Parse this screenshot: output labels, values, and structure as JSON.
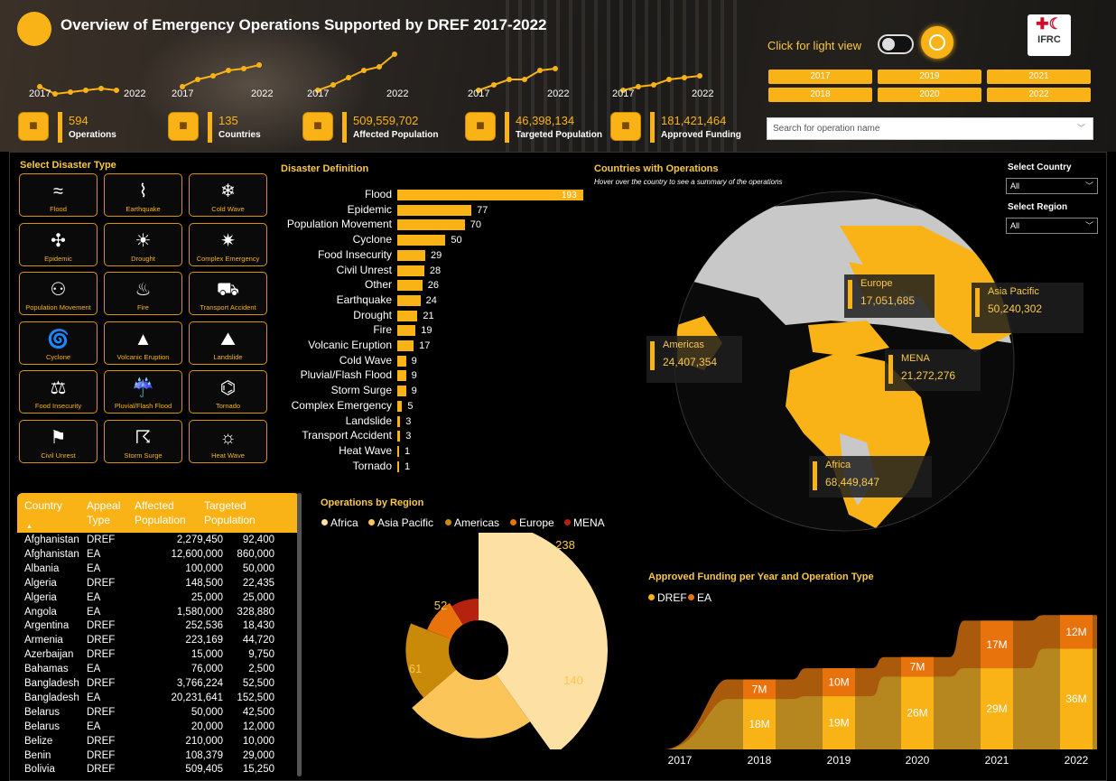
{
  "header": {
    "title": "Overview of Emergency Operations Supported by DREF 2017-2022",
    "light_view_label": "Click for light view",
    "logo_text": "IFRC",
    "search_placeholder": "Search for operation name"
  },
  "kpis": [
    {
      "value": "594",
      "label": "Operations",
      "icon": "people-icon"
    },
    {
      "value": "135",
      "label": "Countries",
      "icon": "map-pin-icon"
    },
    {
      "value": "509,559,702",
      "label": "Affected Population",
      "icon": "family-icon"
    },
    {
      "value": "46,398,134",
      "label": "Targeted Population",
      "icon": "target-people-icon"
    },
    {
      "value": "181,421,464",
      "label": "Approved Funding",
      "icon": "money-icon"
    }
  ],
  "sparklines": [
    {
      "start": "2017",
      "end": "2022"
    },
    {
      "start": "2017",
      "end": "2022"
    },
    {
      "start": "2017",
      "end": "2022"
    },
    {
      "start": "2017",
      "end": "2022"
    },
    {
      "start": "2017",
      "end": "2022"
    }
  ],
  "year_buttons": [
    "2017",
    "2019",
    "2021",
    "2018",
    "2020",
    "2022"
  ],
  "disaster_types": {
    "title": "Select Disaster Type",
    "items": [
      {
        "label": "Flood",
        "icon": "flood-icon",
        "glyph": "≈"
      },
      {
        "label": "Earthquake",
        "icon": "earthquake-icon",
        "glyph": "⌇"
      },
      {
        "label": "Cold Wave",
        "icon": "cold-wave-icon",
        "glyph": "❄"
      },
      {
        "label": "Epidemic",
        "icon": "epidemic-icon",
        "glyph": "✣"
      },
      {
        "label": "Drought",
        "icon": "drought-icon",
        "glyph": "☀"
      },
      {
        "label": "Complex Emergency",
        "icon": "complex-emergency-icon",
        "glyph": "✷"
      },
      {
        "label": "Population Movement",
        "icon": "population-movement-icon",
        "glyph": "⚇"
      },
      {
        "label": "Fire",
        "icon": "fire-icon",
        "glyph": "♨"
      },
      {
        "label": "Transport Accident",
        "icon": "transport-accident-icon",
        "glyph": "⛟"
      },
      {
        "label": "Cyclone",
        "icon": "cyclone-icon",
        "glyph": "🌀"
      },
      {
        "label": "Volcanic Eruption",
        "icon": "volcanic-eruption-icon",
        "glyph": "▲"
      },
      {
        "label": "Landslide",
        "icon": "landslide-icon",
        "glyph": "⛰"
      },
      {
        "label": "Food Insecurity",
        "icon": "food-insecurity-icon",
        "glyph": "⚖"
      },
      {
        "label": "Pluvial/Flash Flood",
        "icon": "flash-flood-icon",
        "glyph": "☔"
      },
      {
        "label": "Tornado",
        "icon": "tornado-icon",
        "glyph": "⌬"
      },
      {
        "label": "Civil Unrest",
        "icon": "civil-unrest-icon",
        "glyph": "⚑"
      },
      {
        "label": "Storm Surge",
        "icon": "storm-surge-icon",
        "glyph": "☈"
      },
      {
        "label": "Heat Wave",
        "icon": "heat-wave-icon",
        "glyph": "☼"
      }
    ]
  },
  "disaster_definition": {
    "title": "Disaster Definition",
    "chart_data": {
      "type": "bar",
      "categories": [
        "Flood",
        "Epidemic",
        "Population Movement",
        "Cyclone",
        "Food Insecurity",
        "Civil Unrest",
        "Other",
        "Earthquake",
        "Drought",
        "Fire",
        "Volcanic Eruption",
        "Cold Wave",
        "Pluvial/Flash Flood",
        "Storm Surge",
        "Complex Emergency",
        "Landslide",
        "Transport Accident",
        "Heat Wave",
        "Tornado"
      ],
      "values": [
        193,
        77,
        70,
        50,
        29,
        28,
        26,
        24,
        21,
        19,
        17,
        9,
        9,
        9,
        5,
        3,
        3,
        1,
        1
      ]
    }
  },
  "map": {
    "title": "Countries with Operations",
    "subtitle": "Hover over the country to see a summary of the operations",
    "select_country_label": "Select Country",
    "select_country_value": "All",
    "select_region_label": "Select Region",
    "select_region_value": "All",
    "regions": [
      {
        "name": "Europe",
        "value": "17,051,685"
      },
      {
        "name": "Asia Pacific",
        "value": "50,240,302"
      },
      {
        "name": "Americas",
        "value": "24,407,354"
      },
      {
        "name": "MENA",
        "value": "21,272,276"
      },
      {
        "name": "Africa",
        "value": "68,449,847"
      }
    ]
  },
  "table": {
    "headers": {
      "country": "Country",
      "appeal_line1": "Appeal",
      "appeal_line2": "Type",
      "affected_line1": "Affected",
      "affected_line2": "Population",
      "targeted_line1": "Targeted",
      "targeted_line2": "Population"
    },
    "rows": [
      [
        "Afghanistan",
        "DREF",
        "2,279,450",
        "92,400"
      ],
      [
        "Afghanistan",
        "EA",
        "12,600,000",
        "860,000"
      ],
      [
        "Albania",
        "EA",
        "100,000",
        "50,000"
      ],
      [
        "Algeria",
        "DREF",
        "148,500",
        "22,435"
      ],
      [
        "Algeria",
        "EA",
        "25,000",
        "25,000"
      ],
      [
        "Angola",
        "EA",
        "1,580,000",
        "328,880"
      ],
      [
        "Argentina",
        "DREF",
        "252,536",
        "18,430"
      ],
      [
        "Armenia",
        "DREF",
        "223,169",
        "44,720"
      ],
      [
        "Azerbaijan",
        "DREF",
        "15,000",
        "9,750"
      ],
      [
        "Bahamas",
        "EA",
        "76,000",
        "2,500"
      ],
      [
        "Bangladesh",
        "DREF",
        "3,766,224",
        "52,500"
      ],
      [
        "Bangladesh",
        "EA",
        "20,231,641",
        "152,500"
      ],
      [
        "Belarus",
        "DREF",
        "50,000",
        "42,500"
      ],
      [
        "Belarus",
        "EA",
        "20,000",
        "12,000"
      ],
      [
        "Belize",
        "DREF",
        "210,000",
        "10,000"
      ],
      [
        "Benin",
        "DREF",
        "108,379",
        "29,000"
      ],
      [
        "Bolivia",
        "DREF",
        "509,405",
        "15,250"
      ]
    ]
  },
  "operations_by_region": {
    "title": "Operations by Region",
    "chart_data": {
      "type": "pie",
      "categories": [
        "Africa",
        "Asia Pacific",
        "Americas",
        "Europe",
        "MENA"
      ],
      "values": [
        238,
        140,
        103,
        61,
        52
      ],
      "colors": [
        "#fde0a4",
        "#fbc55a",
        "#c98a0a",
        "#e8720c",
        "#b5230e"
      ]
    }
  },
  "funding": {
    "title": "Approved Funding per Year and Operation Type",
    "chart_data": {
      "type": "area",
      "x": [
        "2017",
        "2018",
        "2019",
        "2020",
        "2021",
        "2022"
      ],
      "series": [
        {
          "name": "DREF",
          "values": [
            null,
            18,
            19,
            26,
            29,
            36
          ],
          "labels": [
            "",
            "18M",
            "19M",
            "26M",
            "29M",
            "36M"
          ],
          "color": "#f9b316"
        },
        {
          "name": "EA",
          "values": [
            null,
            7,
            10,
            7,
            17,
            12
          ],
          "labels": [
            "",
            "7M",
            "10M",
            "7M",
            "17M",
            "12M"
          ],
          "color": "#e8720c"
        }
      ]
    }
  }
}
